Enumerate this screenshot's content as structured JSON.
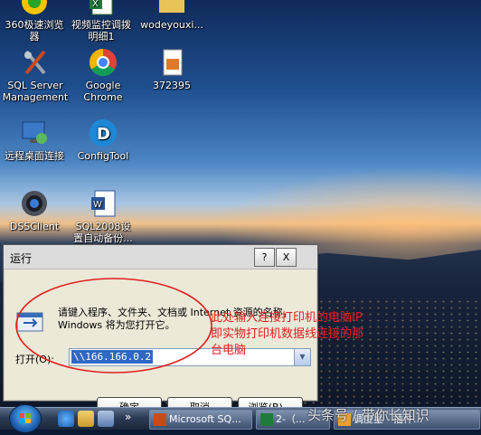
{
  "desktop": {
    "icons": [
      {
        "label_lines": [
          "360极速浏览",
          "器"
        ]
      },
      {
        "label_lines": [
          "视频监控调拨",
          "明细1"
        ]
      },
      {
        "label_lines": [
          "wodeyouxi..."
        ]
      },
      {
        "label_lines": [
          "SQL Server",
          "Management"
        ]
      },
      {
        "label_lines": [
          "Google",
          "Chrome"
        ]
      },
      {
        "label_lines": [
          "372395"
        ]
      },
      {
        "label_lines": [
          "远程桌面连接"
        ]
      },
      {
        "label_lines": [
          "ConfigTool"
        ]
      },
      {
        "label_lines": [
          "DSSClient"
        ]
      },
      {
        "label_lines": [
          "SQL2008设",
          "置自动备份..."
        ]
      }
    ]
  },
  "run_dialog": {
    "title": "运行",
    "help_glyph": "?",
    "close_glyph": "X",
    "description": "请键入程序、文件夹、文档或 Internet 资源的名称，Windows 将为您打开它。",
    "open_label": "打开(O):",
    "open_value": "\\\\166.166.0.2",
    "ok_label": "确定",
    "cancel_label": "取消",
    "browse_label": "浏览(B)..."
  },
  "annotation": {
    "lines": [
      "此处输入连接打印机的电脑IP",
      "即实物打印机数据线连接的那",
      "台电脑"
    ],
    "color": "#e02020"
  },
  "taskbar": {
    "more_glyph": "»",
    "tasks": [
      {
        "label": "Microsoft SQ..."
      },
      {
        "label": "2-（..."
      },
      {
        "label": "调度星 - 插件..."
      }
    ]
  },
  "watermark": "头条号 / 带你长知识"
}
